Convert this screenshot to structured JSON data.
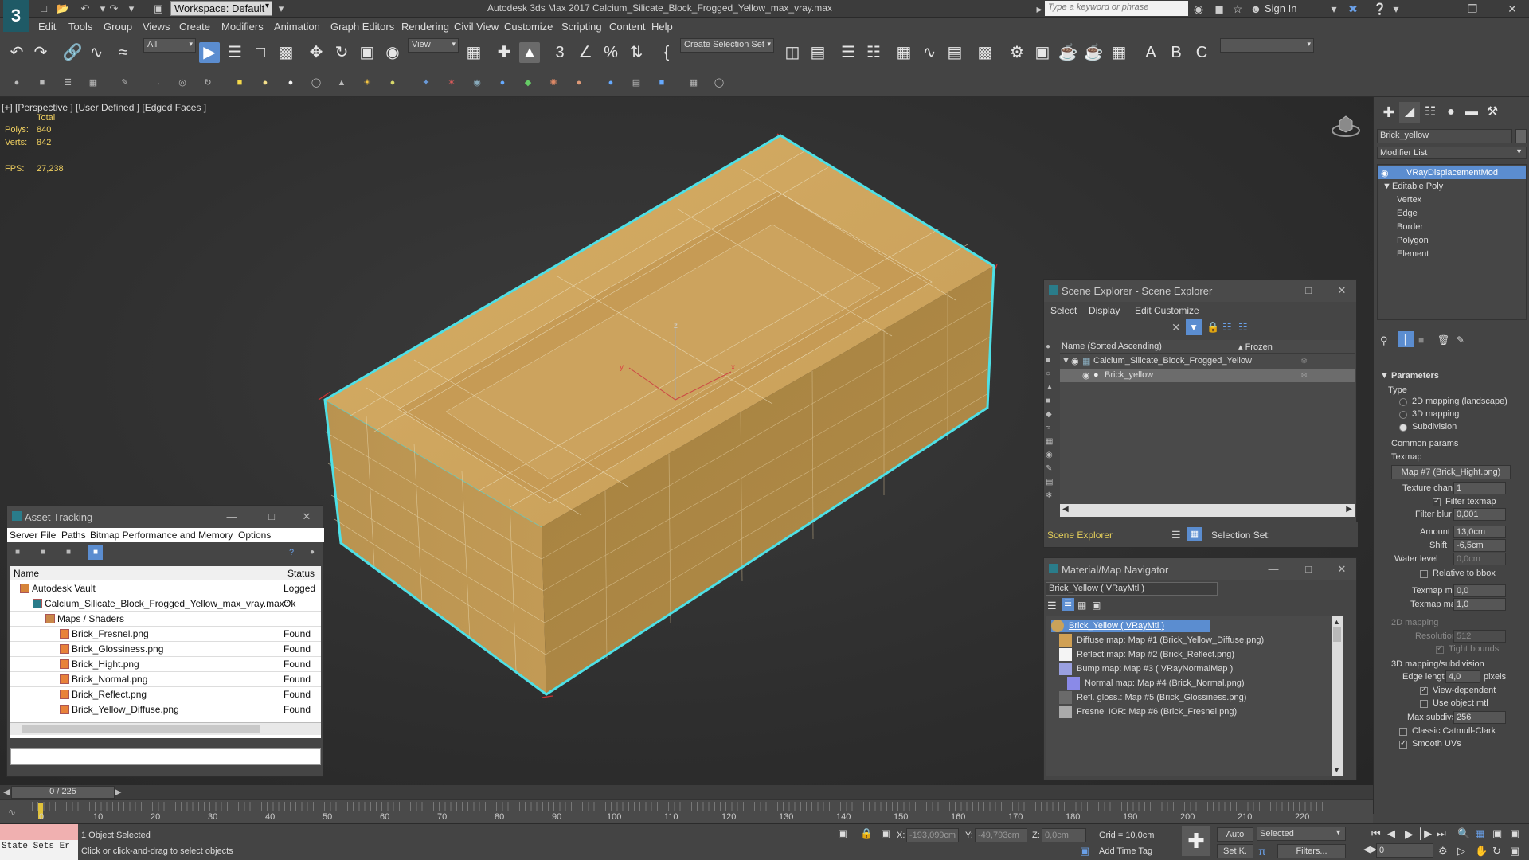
{
  "titlebar": {
    "app_logo": "3",
    "workspace": "Workspace: Default",
    "title": "Autodesk 3ds Max 2017    Calcium_Silicate_Block_Frogged_Yellow_max_vray.max",
    "search_placeholder": "Type a keyword or phrase",
    "sign_in": "Sign In"
  },
  "menu": [
    "Edit",
    "Tools",
    "Group",
    "Views",
    "Create",
    "Modifiers",
    "Animation",
    "Graph Editors",
    "Rendering",
    "Civil View",
    "Customize",
    "Scripting",
    "Content",
    "Help"
  ],
  "toolbar": {
    "filter": "All",
    "view": "View",
    "selection_set": "Create Selection Set"
  },
  "viewport": {
    "label": "[+] [Perspective ] [User Defined ] [Edged Faces ]",
    "total_label": "Total",
    "polys_label": "Polys:",
    "polys_value": "840",
    "verts_label": "Verts:",
    "verts_value": "842",
    "fps_label": "FPS:",
    "fps_value": "27,238"
  },
  "asset_tracking": {
    "title": "Asset Tracking",
    "menus": [
      "Server",
      "File",
      "Paths",
      "Bitmap Performance and Memory",
      "Options"
    ],
    "col_name": "Name",
    "col_status": "Status",
    "rows": [
      {
        "name": "Autodesk Vault",
        "status": "Logged ..."
      },
      {
        "name": "Calcium_Silicate_Block_Frogged_Yellow_max_vray.max",
        "status": "Ok"
      },
      {
        "name": "Maps / Shaders",
        "status": ""
      },
      {
        "name": "Brick_Fresnel.png",
        "status": "Found"
      },
      {
        "name": "Brick_Glossiness.png",
        "status": "Found"
      },
      {
        "name": "Brick_Hight.png",
        "status": "Found"
      },
      {
        "name": "Brick_Normal.png",
        "status": "Found"
      },
      {
        "name": "Brick_Reflect.png",
        "status": "Found"
      },
      {
        "name": "Brick_Yellow_Diffuse.png",
        "status": "Found"
      }
    ]
  },
  "scene_explorer": {
    "title": "Scene Explorer - Scene Explorer",
    "menus": [
      "Select",
      "Display",
      "Edit",
      "Customize"
    ],
    "col_name": "Name (Sorted Ascending)",
    "col_frozen": "▴ Frozen",
    "rows": [
      "Calcium_Silicate_Block_Frogged_Yellow",
      "Brick_yellow"
    ],
    "footer_label": "Scene Explorer",
    "selection_set": "Selection Set:"
  },
  "material_navigator": {
    "title": "Material/Map Navigator",
    "current": "Brick_Yellow  ( VRayMtl )",
    "rows": [
      "Brick_Yellow  ( VRayMtl )",
      "Diffuse map: Map #1 (Brick_Yellow_Diffuse.png)",
      "Reflect map: Map #2 (Brick_Reflect.png)",
      "Bump map: Map #3  ( VRayNormalMap )",
      "Normal map: Map #4 (Brick_Normal.png)",
      "Refl. gloss.: Map #5 (Brick_Glossiness.png)",
      "Fresnel IOR: Map #6 (Brick_Fresnel.png)"
    ]
  },
  "command_panel": {
    "object_name": "Brick_yellow",
    "modifier_list": "Modifier List",
    "stack": [
      "VRayDisplacementMod",
      "Editable Poly",
      "Vertex",
      "Edge",
      "Border",
      "Polygon",
      "Element"
    ],
    "parameters": "Parameters",
    "type_label": "Type",
    "types": [
      "2D mapping (landscape)",
      "3D mapping",
      "Subdivision"
    ],
    "common_params": "Common params",
    "texmap_label": "Texmap",
    "texmap_value": "Map #7 (Brick_Hight.png)",
    "texture_chan_label": "Texture chan",
    "texture_chan_value": "1",
    "filter_texmap": "Filter texmap",
    "filter_blur_label": "Filter blur",
    "filter_blur_value": "0,001",
    "amount_label": "Amount",
    "amount_value": "13,0cm",
    "shift_label": "Shift",
    "shift_value": "-6,5cm",
    "water_level_label": "Water level",
    "water_level_value": "0,0cm",
    "relative_bbox": "Relative to bbox",
    "texmap_min_label": "Texmap min",
    "texmap_min_value": "0,0",
    "texmap_max_label": "Texmap max",
    "texmap_max_value": "1,0",
    "mapping_2d": "2D mapping",
    "resolution_label": "Resolution",
    "resolution_value": "512",
    "tight_bounds": "Tight bounds",
    "mapping_3d": "3D mapping/subdivision",
    "edge_length_label": "Edge length",
    "edge_length_value": "4,0",
    "pixels": "pixels",
    "view_dependent": "View-dependent",
    "use_object_mtl": "Use object mtl",
    "max_subdivs_label": "Max subdivs",
    "max_subdivs_value": "256",
    "classic_catmull": "Classic Catmull-Clark",
    "smooth_uvs": "Smooth UVs"
  },
  "timeline": {
    "frame": "0 / 225",
    "ticks": [
      "0",
      "10",
      "20",
      "30",
      "40",
      "50",
      "60",
      "70",
      "80",
      "90",
      "100",
      "110",
      "120",
      "130",
      "140",
      "150",
      "160",
      "170",
      "180",
      "190",
      "200",
      "210",
      "220"
    ]
  },
  "status": {
    "state_sets": "State Sets Er",
    "selected": "1 Object Selected",
    "prompt": "Click or click-and-drag to select objects",
    "x_label": "X:",
    "x_value": "-193,099cm",
    "y_label": "Y:",
    "y_value": "-49,793cm",
    "z_label": "Z:",
    "z_value": "0,0cm",
    "grid": "Grid = 10,0cm",
    "add_time_tag": "Add Time Tag",
    "auto": "Auto",
    "selected_combo": "Selected",
    "set_k": "Set K.",
    "filters": "Filters...",
    "frame_value": "0"
  },
  "colors": {
    "accent": "#5b8dd0",
    "brick": "#c9a25a",
    "selection_outline": "#4ee0e6"
  }
}
